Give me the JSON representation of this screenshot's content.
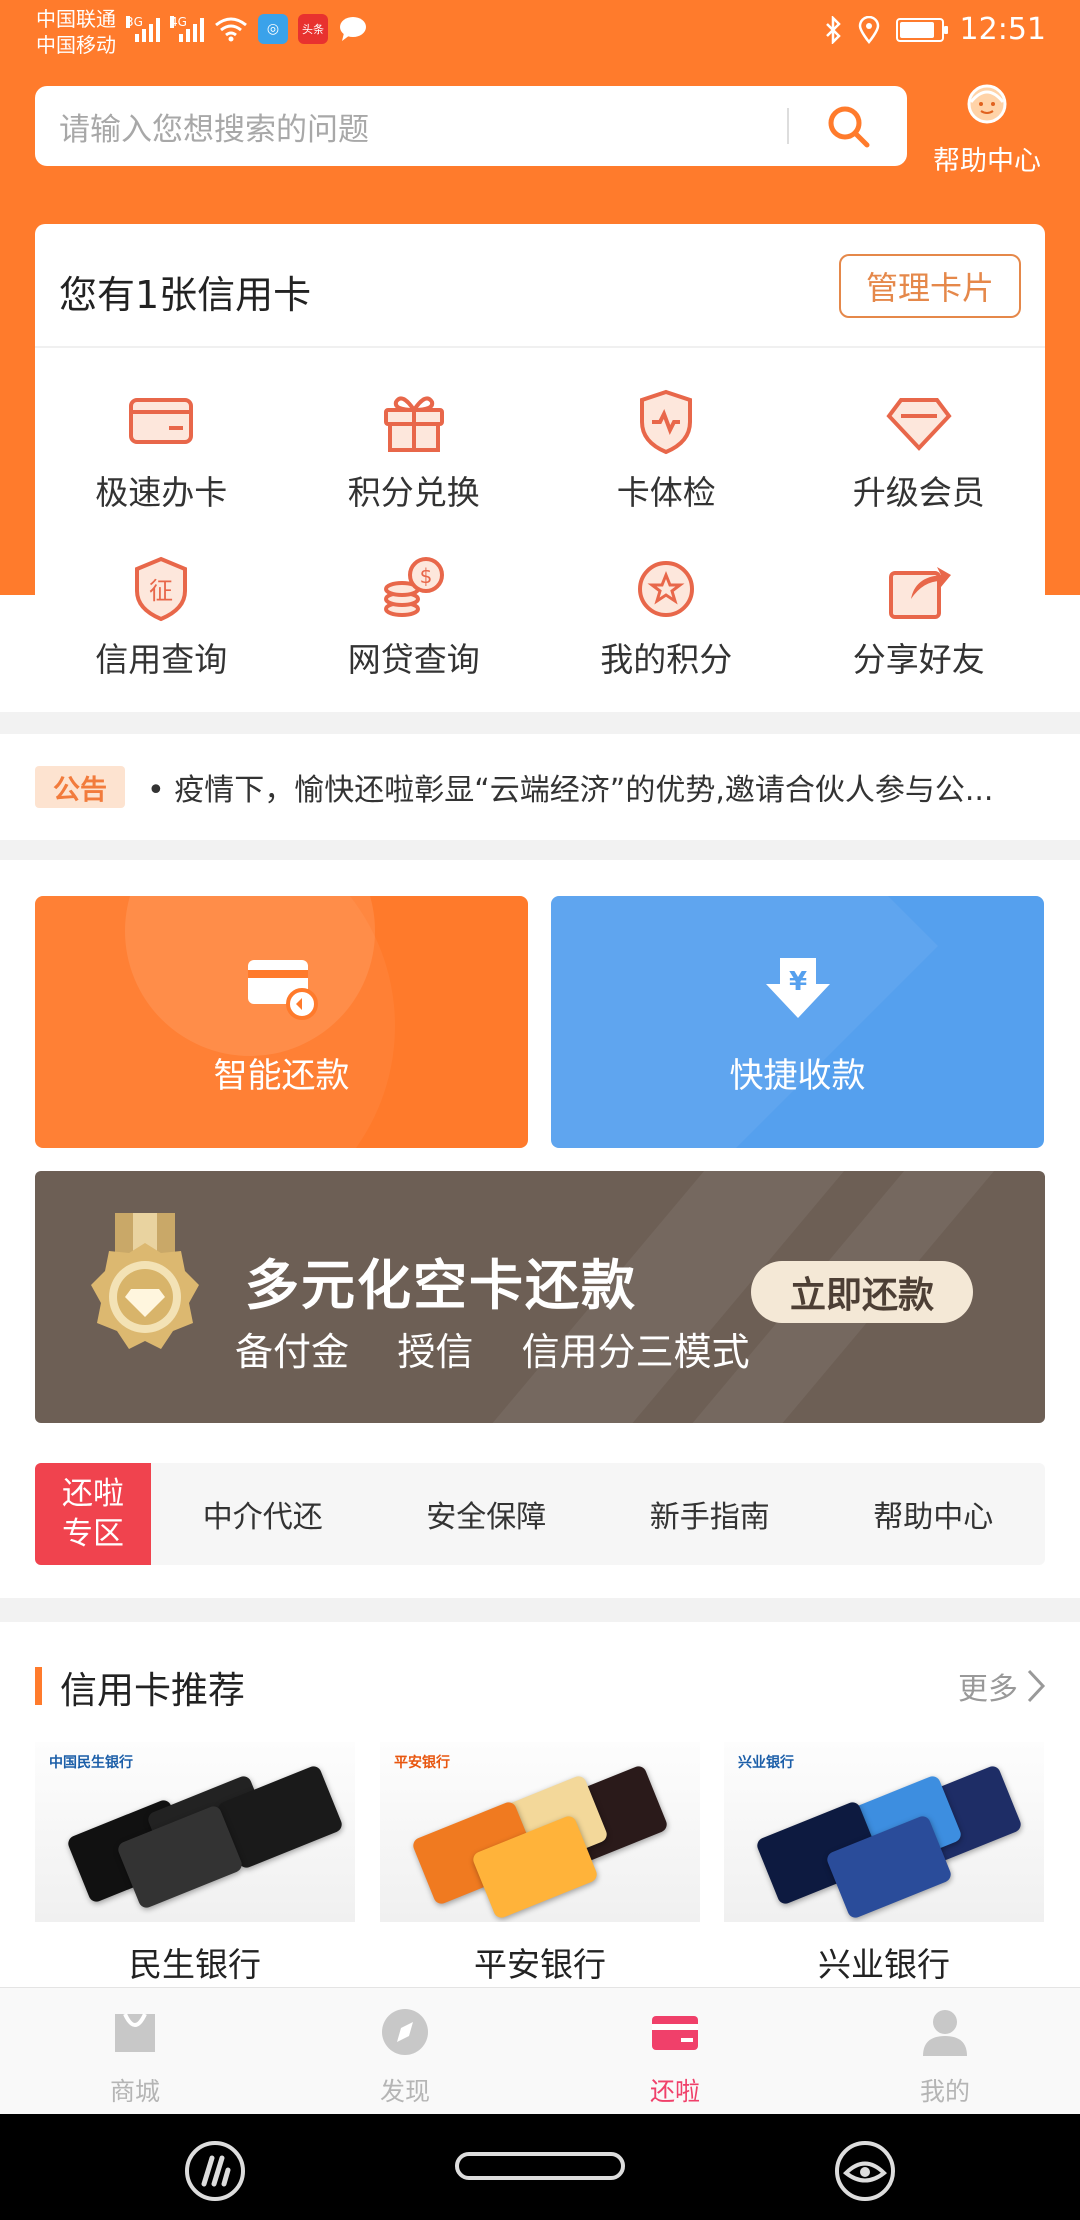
{
  "status_bar": {
    "carrier_1": "中国联通",
    "carrier_2": "中国移动",
    "net_1": "3G",
    "net_2": "4G",
    "app_icon_label": "头条",
    "time": "12:51"
  },
  "search": {
    "placeholder": "请输入您想搜索的问题"
  },
  "help_center": {
    "label": "帮助中心"
  },
  "card_panel": {
    "count_text": "您有1张信用卡",
    "manage_label": "管理卡片",
    "items": [
      {
        "label": "极速办卡",
        "icon": "card-icon"
      },
      {
        "label": "积分兑换",
        "icon": "gift-icon"
      },
      {
        "label": "卡体检",
        "icon": "shield-check-icon"
      },
      {
        "label": "升级会员",
        "icon": "diamond-icon"
      },
      {
        "label": "信用查询",
        "icon": "credit-badge-icon"
      },
      {
        "label": "网贷查询",
        "icon": "coins-icon"
      },
      {
        "label": "我的积分",
        "icon": "star-icon"
      },
      {
        "label": "分享好友",
        "icon": "share-icon"
      }
    ]
  },
  "notice": {
    "tag": "公告",
    "text": "• 疫情下，愉快还啦彰显“云端经济”的优势,邀请合伙人参与公..."
  },
  "tiles": {
    "smart_repay": "智能还款",
    "quick_collect": "快捷收款"
  },
  "banner": {
    "title": "多元化空卡还款",
    "subtitle": "备付金    授信    信用分三模式",
    "button": "立即还款"
  },
  "zone": {
    "tag_line1": "还啦",
    "tag_line2": "专区",
    "links": [
      "中介代还",
      "安全保障",
      "新手指南",
      "帮助中心"
    ]
  },
  "recommend": {
    "title": "信用卡推荐",
    "more": "更多",
    "banks": [
      {
        "name": "民生银行",
        "logo_text": "中国民生银行"
      },
      {
        "name": "平安银行",
        "logo_text": "平安银行"
      },
      {
        "name": "兴业银行",
        "logo_text": "兴业银行"
      }
    ]
  },
  "bottom_nav": {
    "items": [
      {
        "label": "商城",
        "icon": "bag-icon"
      },
      {
        "label": "发现",
        "icon": "compass-icon"
      },
      {
        "label": "还啦",
        "icon": "card-icon"
      },
      {
        "label": "我的",
        "icon": "user-icon"
      }
    ],
    "active": "还啦"
  },
  "colors": {
    "brand_orange": "#ff7b2c",
    "blue_tile": "#55a0ee",
    "zone_red": "#f0434e",
    "nav_active": "#f0406a"
  }
}
